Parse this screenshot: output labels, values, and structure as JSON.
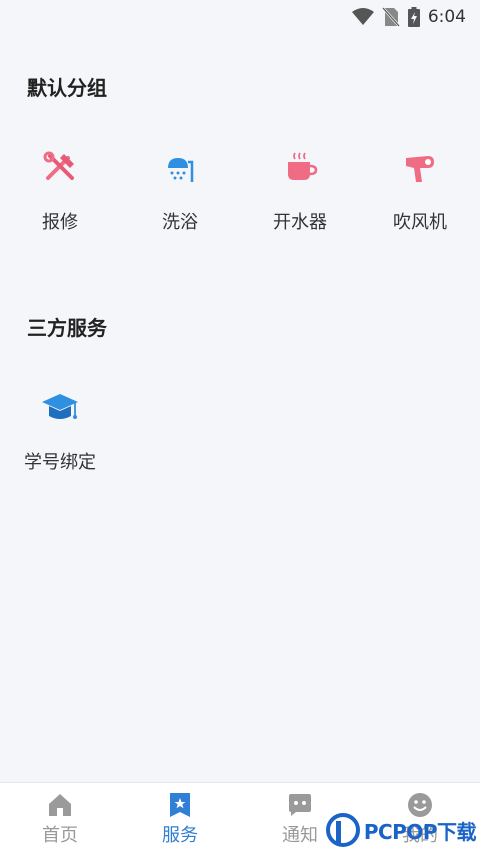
{
  "status": {
    "time": "6:04"
  },
  "sections": [
    {
      "title": "默认分组",
      "items": [
        {
          "label": "报修",
          "icon": "repair-tools-icon"
        },
        {
          "label": "洗浴",
          "icon": "shower-icon"
        },
        {
          "label": "开水器",
          "icon": "hot-cup-icon"
        },
        {
          "label": "吹风机",
          "icon": "hair-dryer-icon"
        }
      ]
    },
    {
      "title": "三方服务",
      "items": [
        {
          "label": "学号绑定",
          "icon": "graduation-cap-icon"
        }
      ]
    }
  ],
  "tabbar": {
    "tabs": [
      {
        "label": "首页",
        "icon": "home-icon"
      },
      {
        "label": "服务",
        "icon": "service-icon",
        "active": true
      },
      {
        "label": "通知",
        "icon": "chat-icon"
      },
      {
        "label": "我的",
        "icon": "smile-icon"
      }
    ]
  },
  "colors": {
    "accent": "#2f7fd6",
    "pink": "#f06b84",
    "background": "#f5f6fa"
  },
  "watermark": {
    "text": "PCPOP下载"
  }
}
